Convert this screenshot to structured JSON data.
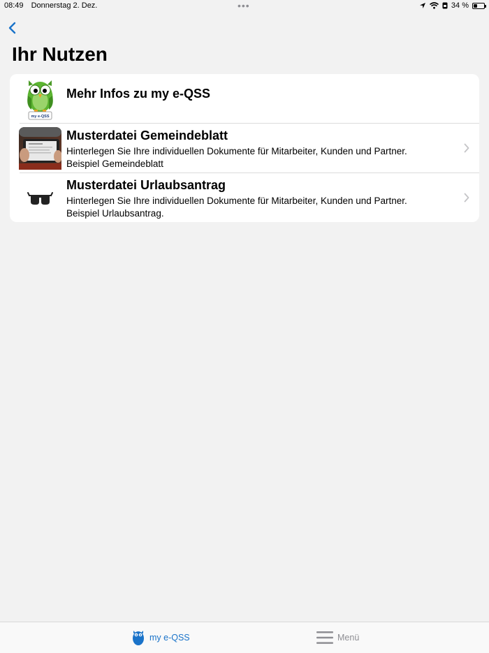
{
  "status_bar": {
    "time": "08:49",
    "date": "Donnerstag 2. Dez.",
    "dots": "•••",
    "battery": "34 %",
    "battery_level": 0.34
  },
  "nav": {
    "back_icon": "chevron-left-icon",
    "title": "Ihr Nutzen"
  },
  "list": {
    "items": [
      {
        "icon": "owl-mascot-icon",
        "title": "Mehr Infos zu my e-QSS",
        "line1": "",
        "line2": ""
      },
      {
        "icon": "tablet-photo",
        "title": "Musterdatei Gemeindeblatt",
        "line1": "Hinterlegen Sie Ihre individuellen Dokumente für Mitarbeiter, Kunden und Partner.",
        "line2": "Beispiel Gemeindeblatt"
      },
      {
        "icon": "glasses-icon",
        "title": "Musterdatei Urlaubsantrag",
        "line1": "Hinterlegen Sie Ihre individuellen Dokumente für Mitarbeiter, Kunden und Partner.",
        "line2": "Beispiel Urlaubsantrag."
      }
    ]
  },
  "owl_badge": "my e-QSS",
  "tab_bar": {
    "tabs": [
      {
        "label": "my e-QSS",
        "icon": "owl-tab-icon",
        "selected": true
      },
      {
        "label": "Menü",
        "icon": "hamburger-menu-icon",
        "selected": false
      }
    ]
  },
  "colors": {
    "accent": "#1a73c9",
    "background": "#f2f2f2",
    "card": "#ffffff",
    "owl_green": "#5cb531"
  }
}
